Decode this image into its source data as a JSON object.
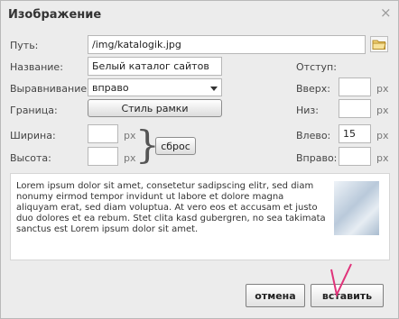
{
  "dialog": {
    "title": "Изображение",
    "close_glyph": "×"
  },
  "fields": {
    "path_label": "Путь:",
    "path_value": "/img/katalogik.jpg",
    "name_label": "Название:",
    "name_value": "Белый каталог сайтов",
    "align_label": "Выравнивание:",
    "align_value": "вправо",
    "border_label": "Граница:",
    "border_button": "Стиль рамки",
    "width_label": "Ширина:",
    "width_value": "",
    "height_label": "Высота:",
    "height_value": "",
    "unit": "px",
    "reset_button": "сброс",
    "indent_label": "Отступ:",
    "top_label": "Вверх:",
    "top_value": "",
    "bottom_label": "Низ:",
    "bottom_value": "",
    "left_label": "Влево:",
    "left_value": "15",
    "right_label": "Вправо:",
    "right_value": ""
  },
  "preview": {
    "text": "Lorem ipsum dolor sit amet, consetetur sadipscing elitr, sed diam nonumy eirmod tempor invidunt ut labore et dolore magna aliquyam erat, sed diam voluptua. At vero eos et accusam et justo duo dolores et ea rebum. Stet clita kasd gubergren, no sea takimata sanctus est Lorem ipsum dolor sit amet."
  },
  "buttons": {
    "cancel": "отмена",
    "insert": "вставить"
  },
  "icons": {
    "folder": "folder-icon",
    "close": "close-icon",
    "dropdown": "chevron-down-icon"
  }
}
